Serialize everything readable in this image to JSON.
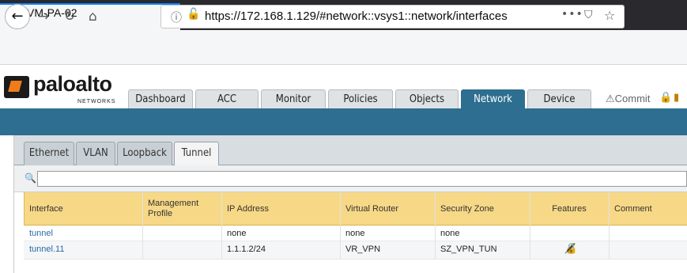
{
  "browser": {
    "tab_title": "VM-PA-02",
    "tab_close": "×",
    "new_tab": "+",
    "url": "https://172.168.1.129/#network::vsys1::network/interfaces",
    "url_menu": "•••"
  },
  "app": {
    "logo_text": "paloalto",
    "logo_sub": "NETWORKS",
    "nav_tabs": [
      {
        "label": "Dashboard"
      },
      {
        "label": "ACC"
      },
      {
        "label": "Monitor"
      },
      {
        "label": "Policies"
      },
      {
        "label": "Objects"
      },
      {
        "label": "Network"
      },
      {
        "label": "Device"
      }
    ],
    "active_nav": "Network",
    "commit_label": "Commit",
    "colors": {
      "nav_active": "#2e6e90",
      "header_row": "#f7d886",
      "link": "#2c6aa5"
    }
  },
  "interfaces": {
    "sub_tabs": [
      {
        "label": "Ethernet"
      },
      {
        "label": "VLAN"
      },
      {
        "label": "Loopback"
      },
      {
        "label": "Tunnel"
      }
    ],
    "active_sub_tab": "Tunnel",
    "search_value": "",
    "columns": [
      "Interface",
      "Management Profile",
      "IP Address",
      "Virtual Router",
      "Security Zone",
      "Features",
      "Comment"
    ],
    "rows": [
      {
        "interface": "tunnel",
        "management_profile": "",
        "ip_address": "none",
        "virtual_router": "none",
        "security_zone": "none",
        "features": "",
        "comment": ""
      },
      {
        "interface": "tunnel.11",
        "management_profile": "",
        "ip_address": "1.1.1.2/24",
        "virtual_router": "VR_VPN",
        "security_zone": "SZ_VPN_TUN",
        "features": "lock-icon",
        "comment": ""
      }
    ]
  }
}
